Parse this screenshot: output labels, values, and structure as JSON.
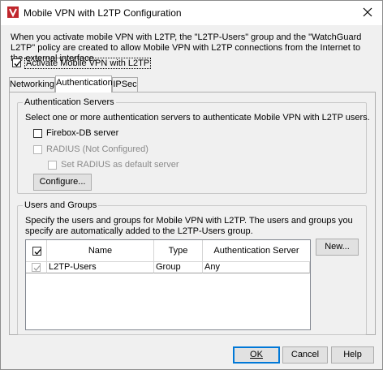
{
  "window": {
    "title": "Mobile VPN with L2TP Configuration",
    "description": "When you activate mobile VPN with L2TP, the \"L2TP-Users\" group and the \"WatchGuard L2TP\" policy are created to allow Mobile VPN with L2TP connections from the Internet to the external interface."
  },
  "activate": {
    "label": "Activate Mobile VPN with L2TP",
    "checked": true
  },
  "tabs": [
    {
      "label": "Networking",
      "active": false
    },
    {
      "label": "Authentication",
      "active": true
    },
    {
      "label": "IPSec",
      "active": false
    }
  ],
  "auth_servers": {
    "title": "Authentication Servers",
    "description": "Select one or more authentication servers to authenticate Mobile VPN with L2TP users.",
    "firebox_label": "Firebox-DB server",
    "firebox_checked": false,
    "radius_label": "RADIUS (Not Configured)",
    "radius_enabled": false,
    "radius_default_label": "Set RADIUS as default server",
    "configure_button": "Configure..."
  },
  "users_groups": {
    "title": "Users and Groups",
    "description": "Specify the users and groups for Mobile VPN with L2TP. The users and groups you specify are automatically added to the L2TP-Users group.",
    "columns": [
      "Name",
      "Type",
      "Authentication Server"
    ],
    "rows": [
      {
        "checked": true,
        "name": "L2TP-Users",
        "type": "Group",
        "server": "Any"
      }
    ],
    "new_button": "New..."
  },
  "footer": {
    "ok": "OK",
    "cancel": "Cancel",
    "help": "Help"
  },
  "colors": {
    "accent": "#0078d7",
    "app_icon": "#c0262c"
  }
}
